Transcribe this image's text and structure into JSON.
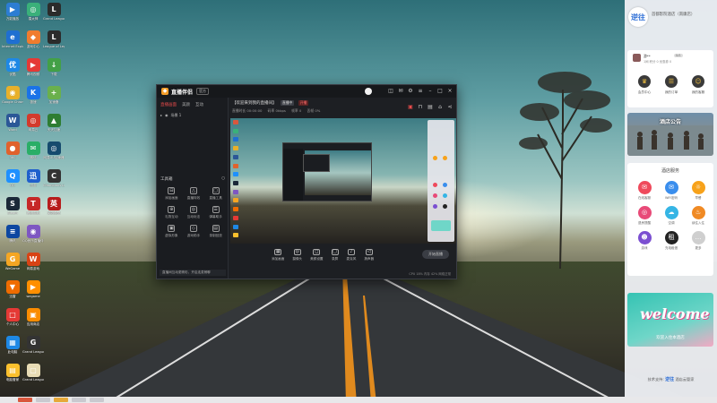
{
  "desktop": {
    "icons": [
      {
        "label": "万能播放",
        "color": "#2c7dd3",
        "glyph": "▶",
        "col": 0,
        "row": 0
      },
      {
        "label": "猿太神",
        "color": "#3ab07a",
        "glyph": "◎",
        "col": 1,
        "row": 0
      },
      {
        "label": "Grand League of",
        "color": "#2b2b2b",
        "glyph": "L",
        "col": 2,
        "row": 0
      },
      {
        "label": "Internet Explorer",
        "color": "#1f6fd1",
        "glyph": "e",
        "col": 0,
        "row": 1
      },
      {
        "label": "游戏中心",
        "color": "#f07c2e",
        "glyph": "◆",
        "col": 1,
        "row": 1
      },
      {
        "label": "League of Legends",
        "color": "#2b2b2b",
        "glyph": "L",
        "col": 2,
        "row": 1
      },
      {
        "label": "优酷",
        "color": "#1e88e5",
        "glyph": "优",
        "col": 0,
        "row": 2
      },
      {
        "label": "腾讯视频",
        "color": "#e53935",
        "glyph": "▶",
        "col": 1,
        "row": 2
      },
      {
        "label": "下载",
        "color": "#43a047",
        "glyph": "↓",
        "col": 2,
        "row": 2
      },
      {
        "label": "Google Chrome",
        "color": "#e8b02a",
        "glyph": "◉",
        "col": 0,
        "row": 3
      },
      {
        "label": "极速",
        "color": "#1a73e8",
        "glyph": "K",
        "col": 1,
        "row": 3
      },
      {
        "label": "加速器",
        "color": "#6ab04c",
        "glyph": "+",
        "col": 2,
        "row": 3
      },
      {
        "label": "Word",
        "color": "#2b5797",
        "glyph": "W",
        "col": 0,
        "row": 4
      },
      {
        "label": "网易云",
        "color": "#d33a2c",
        "glyph": "◎",
        "col": 1,
        "row": 4
      },
      {
        "label": "天天加速",
        "color": "#2e7d32",
        "glyph": "▲",
        "col": 2,
        "row": 4
      },
      {
        "label": "360",
        "color": "#e0622d",
        "glyph": "●",
        "col": 0,
        "row": 5
      },
      {
        "label": "微信",
        "color": "#2aae67",
        "glyph": "✉",
        "col": 1,
        "row": 5
      },
      {
        "label": "网易UU加速器",
        "color": "#164b6e",
        "glyph": "◎",
        "col": 2,
        "row": 5
      },
      {
        "label": "QQ",
        "color": "#1e90ff",
        "glyph": "Q",
        "col": 0,
        "row": 6
      },
      {
        "label": "迅游",
        "color": "#1f5fcc",
        "glyph": "迅",
        "col": 1,
        "row": 6
      },
      {
        "label": "Champions League",
        "color": "#333333",
        "glyph": "C",
        "col": 2,
        "row": 6
      },
      {
        "label": "Steam",
        "color": "#1b2838",
        "glyph": "S",
        "col": 0,
        "row": 7
      },
      {
        "label": "腾讯游戏",
        "color": "#c62828",
        "glyph": "T",
        "col": 1,
        "row": 7
      },
      {
        "label": "英雄联盟",
        "color": "#b71c1c",
        "glyph": "英",
        "col": 2,
        "row": 7
      },
      {
        "label": "腾讯",
        "color": "#0d47a1",
        "glyph": "≡",
        "col": 0,
        "row": 8
      },
      {
        "label": "QQ音乐直播伴侣",
        "color": "#7e57c2",
        "glyph": "◉",
        "col": 1,
        "row": 8
      },
      {
        "label": "WeGame",
        "color": "#f5a623",
        "glyph": "G",
        "col": 0,
        "row": 9
      },
      {
        "label": "网易游戏",
        "color": "#d84315",
        "glyph": "W",
        "col": 1,
        "row": 9
      },
      {
        "label": "迅雷",
        "color": "#ef6c00",
        "glyph": "▼",
        "col": 0,
        "row": 10
      },
      {
        "label": "wegame",
        "color": "#ff8f00",
        "glyph": "▶",
        "col": 1,
        "row": 10
      },
      {
        "label": "个人中心",
        "color": "#e53935",
        "glyph": "□",
        "col": 0,
        "row": 11
      },
      {
        "label": "应用商店",
        "color": "#fb8c00",
        "glyph": "▣",
        "col": 1,
        "row": 11
      },
      {
        "label": "此电脑",
        "color": "#1e88e5",
        "glyph": "▦",
        "col": 0,
        "row": 12
      },
      {
        "label": "Grand League of",
        "color": "#333333",
        "glyph": "G",
        "col": 1,
        "row": 12
      },
      {
        "label": "电脑管家",
        "color": "#fbc02d",
        "glyph": "▤",
        "col": 0,
        "row": 13
      },
      {
        "label": "Grand League",
        "color": "#e8dcb5",
        "glyph": "▢",
        "col": 1,
        "row": 13
      }
    ]
  },
  "app": {
    "brand": "直播伴侣",
    "version": "官方",
    "left_tabs": [
      "直播画面",
      "美颜",
      "互动"
    ],
    "scene": "场景 1",
    "toolbox_title": "工具箱",
    "tools": [
      {
        "icon": "⊟",
        "label": "添加画面"
      },
      {
        "icon": "△",
        "label": "直播特效"
      },
      {
        "icon": "▢",
        "label": "直播工具"
      },
      {
        "icon": "⊕",
        "label": "礼物互动"
      },
      {
        "icon": "◎",
        "label": "互动玩法"
      },
      {
        "icon": "☰",
        "label": "弹幕助手"
      },
      {
        "icon": "▣",
        "label": "虚拟形象"
      },
      {
        "icon": "◇",
        "label": "游戏助手"
      },
      {
        "icon": "▤",
        "label": "录制回放"
      }
    ],
    "notice": "直播间互动更精彩，开启连麦畅聊",
    "stream_title": "【欢迎来到我的直播间】",
    "stream_tags": [
      "直播中",
      "开播"
    ],
    "stream_meta": [
      "直播时长 00:00:00",
      "码率 0kbps",
      "帧率 0",
      "丢帧 0%"
    ],
    "controls": [
      {
        "icon": "▦",
        "label": "添加画面"
      },
      {
        "icon": "◎",
        "label": "摄像头"
      },
      {
        "icon": "◻",
        "label": "美颜设置"
      },
      {
        "icon": "▢",
        "label": "录屏"
      },
      {
        "icon": "♪",
        "label": "麦克风"
      },
      {
        "icon": "◁",
        "label": "扬声器"
      }
    ],
    "start_label": "开始直播",
    "status": "CPU 18%  内存 42%  网络正常"
  },
  "hotel": {
    "logo_text": "逆往",
    "hotel_name": "首都影院酒店（南康店）",
    "user_name": "游**",
    "user_level": "LV1",
    "user_stats": "1间  积分 0  优惠券 0",
    "user_actions": [
      {
        "icon": "♛",
        "label": "会员中心"
      },
      {
        "icon": "☰",
        "label": "我的订单"
      },
      {
        "icon": "☺",
        "label": "我的客服"
      }
    ],
    "notice_title": "酒店公告",
    "services_title": "酒店服务",
    "services": [
      {
        "icon": "✉",
        "label": "在线客服",
        "color": "#ef4a5c"
      },
      {
        "icon": "✉",
        "label": "WiFi密码",
        "color": "#3a8eed"
      },
      {
        "icon": "☼",
        "label": "早餐",
        "color": "#f7a21b"
      },
      {
        "icon": "◎",
        "label": "退房提醒",
        "color": "#e84a78"
      },
      {
        "icon": "☁",
        "label": "空调",
        "color": "#35b5e5"
      },
      {
        "icon": "♨",
        "label": "续住入住",
        "color": "#f08a24"
      },
      {
        "icon": "☻",
        "label": "游戏",
        "color": "#7b4fd1"
      },
      {
        "icon": "租",
        "label": "充电租借",
        "color": "#222222"
      },
      {
        "icon": "…",
        "label": "更多",
        "color": "#cfcfcf"
      }
    ],
    "welcome": "welcome",
    "welcome_sub": "欢迎入住本酒店",
    "footer_prefix": "技术支持:",
    "footer_brand": "逆往",
    "footer_suffix": "酒店云管家"
  }
}
